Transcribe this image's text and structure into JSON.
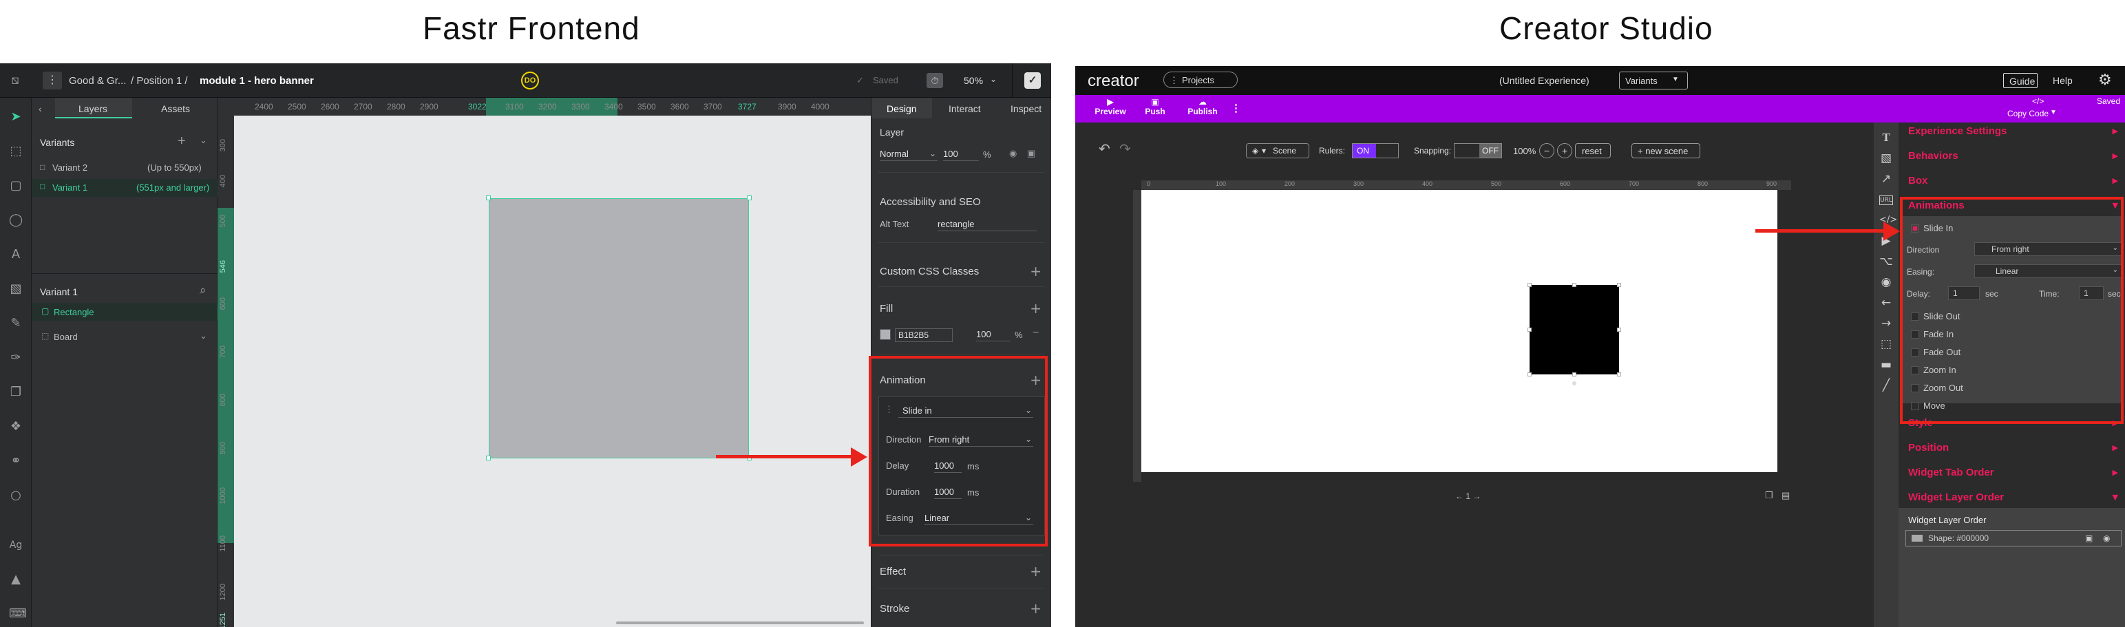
{
  "headers": {
    "left": "Fastr Frontend",
    "right": "Creator Studio"
  },
  "fastr": {
    "breadcrumb": {
      "brand": "Good & Gr...",
      "path": "/ Position 1 /",
      "module": "module 1 - hero banner"
    },
    "saved": "Saved",
    "zoom": "50%",
    "left_tabs": [
      "Layers",
      "Assets"
    ],
    "variants_title": "Variants",
    "variants": [
      {
        "name": "Variant 2",
        "range": "(Up to 550px)"
      },
      {
        "name": "Variant 1",
        "range": "(551px and larger)"
      }
    ],
    "layer_title": "Variant 1",
    "layers": [
      "Rectangle",
      "Board"
    ],
    "ruler_x": [
      "2400",
      "2500",
      "2600",
      "2700",
      "2800",
      "2900",
      "3022",
      "3100",
      "3200",
      "3300",
      "3400",
      "3500",
      "3600",
      "3700",
      "3727",
      "3900",
      "4000"
    ],
    "ruler_y": [
      "300",
      "400",
      "500",
      "546",
      "600",
      "700",
      "800",
      "900",
      "1000",
      "1100",
      "1200",
      "1251",
      "1300",
      "1400"
    ],
    "right_tabs": [
      "Design",
      "Interact",
      "Inspect"
    ],
    "layer_section": "Layer",
    "blend_mode": "Normal",
    "opacity": "100",
    "percent": "%",
    "a11y_title": "Accessibility and SEO",
    "alt_label": "Alt Text",
    "alt_value": "rectangle",
    "css_title": "Custom CSS Classes",
    "fill_title": "Fill",
    "fill_hex": "B1B2B5",
    "fill_opacity": "100",
    "animation_title": "Animation",
    "anim_type": "Slide in",
    "direction_label": "Direction",
    "direction_value": "From right",
    "delay_label": "Delay",
    "delay_value": "1000",
    "duration_label": "Duration",
    "duration_value": "1000",
    "unit_ms": "ms",
    "easing_label": "Easing",
    "easing_value": "Linear",
    "effect_title": "Effect",
    "stroke_title": "Stroke",
    "colors": {
      "accent": "#3ecf9e",
      "red": "#e8231b",
      "shape": "#b1b2b5"
    }
  },
  "creator": {
    "logo": "creator",
    "projects": "Projects",
    "doc_title": "(Untitled Experience)",
    "variants": "Variants",
    "guide": "Guide",
    "help": "Help",
    "saved": "Saved",
    "toolbar": [
      "Preview",
      "Push",
      "Publish"
    ],
    "copy_code": "Copy Code",
    "scene": "Scene",
    "rulers_label": "Rulers:",
    "rulers_on": "ON",
    "snapping_label": "Snapping:",
    "snapping_off": "OFF",
    "zoom": "100%",
    "reset": "reset",
    "new_scene": "+ new scene",
    "page_nav": "← 1 →",
    "ruler_x": [
      "0",
      "100",
      "200",
      "300",
      "400",
      "500",
      "600",
      "700",
      "800",
      "900"
    ],
    "sections": [
      "Experience Settings",
      "Behaviors",
      "Box",
      "Animations"
    ],
    "anim_items": [
      "Slide In",
      "Slide Out",
      "Fade In",
      "Fade Out",
      "Zoom In",
      "Zoom Out",
      "Move"
    ],
    "direction_label": "Direction",
    "direction_value": "From right",
    "easing_label": "Easing:",
    "easing_value": "Linear",
    "delay_label": "Delay:",
    "delay_value": "1",
    "time_label": "Time:",
    "time_value": "1",
    "sec": "sec",
    "sections_after": [
      "Style",
      "Position",
      "Widget Tab Order",
      "Widget Layer Order"
    ],
    "wlo_title": "Widget Layer Order",
    "wlo_item": "Shape: #000000",
    "colors": {
      "brand": "#a100e6",
      "pink": "#ee1a5c",
      "on": "#7b2cff"
    }
  }
}
